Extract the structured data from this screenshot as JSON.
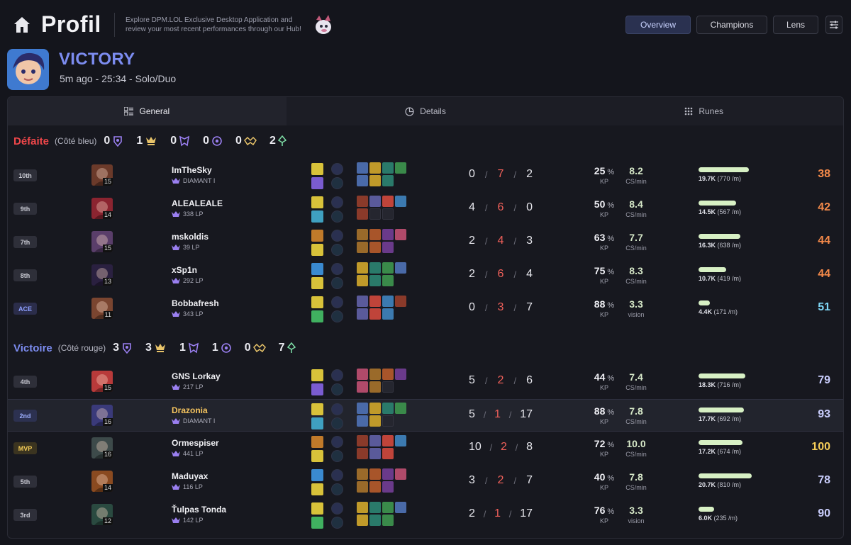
{
  "header": {
    "title": "Profil",
    "promo": "Explore DPM.LOL Exclusive Desktop Application and review your most recent performances through our Hub!",
    "nav": [
      "Overview",
      "Champions",
      "Lens"
    ]
  },
  "match": {
    "result": "VICTORY",
    "meta": "5m ago - 25:34 - Solo/Duo"
  },
  "tabs": [
    "General",
    "Details",
    "Runes"
  ],
  "teams": [
    {
      "name": "Défaite",
      "side": "(Côté bleu)",
      "color": "#f0474a",
      "objectives": [
        "0",
        "1",
        "0",
        "0",
        "0",
        "2"
      ],
      "players": [
        {
          "badge": "10th",
          "champ_color": "#6b3a2a",
          "level": "15",
          "name": "ImTheSky",
          "rank": "DIAMANT I",
          "k": "0",
          "d": "7",
          "a": "2",
          "kp": "25",
          "cs": "8.2",
          "cs_label": "CS/min",
          "dmg": "19.7K",
          "dpm": "(770 /m)",
          "dmg_frac": 0.95,
          "score": "38",
          "score_color": "#f58a4a"
        },
        {
          "badge": "9th",
          "champ_color": "#8b2430",
          "level": "14",
          "name": "ALEALEALE",
          "rank": "338 LP",
          "k": "4",
          "d": "6",
          "a": "0",
          "kp": "50",
          "cs": "8.4",
          "cs_label": "CS/min",
          "dmg": "14.5K",
          "dpm": "(567 /m)",
          "dmg_frac": 0.7,
          "score": "42",
          "score_color": "#f58a4a"
        },
        {
          "badge": "7th",
          "champ_color": "#5a3e6a",
          "level": "15",
          "name": "mskoldis",
          "rank": "39 LP",
          "k": "2",
          "d": "4",
          "a": "3",
          "kp": "63",
          "cs": "7.7",
          "cs_label": "CS/min",
          "dmg": "16.3K",
          "dpm": "(638 /m)",
          "dmg_frac": 0.79,
          "score": "44",
          "score_color": "#f58a4a"
        },
        {
          "badge": "8th",
          "champ_color": "#2a2040",
          "level": "13",
          "name": "xSp1n",
          "rank": "292 LP",
          "k": "2",
          "d": "6",
          "a": "4",
          "kp": "75",
          "cs": "8.3",
          "cs_label": "CS/min",
          "dmg": "10.7K",
          "dpm": "(419 /m)",
          "dmg_frac": 0.52,
          "score": "44",
          "score_color": "#f58a4a"
        },
        {
          "badge": "ACE",
          "champ_color": "#7a4530",
          "level": "11",
          "name": "Bobbafresh",
          "rank": "343 LP",
          "k": "0",
          "d": "3",
          "a": "7",
          "kp": "88",
          "cs": "3.3",
          "cs_label": "vision",
          "dmg": "4.4K",
          "dpm": "(171 /m)",
          "dmg_frac": 0.21,
          "score": "51",
          "score_color": "#7fd6f5"
        }
      ]
    },
    {
      "name": "Victoire",
      "side": "(Côté rouge)",
      "color": "#7c8cf0",
      "objectives": [
        "3",
        "3",
        "1",
        "1",
        "0",
        "7"
      ],
      "players": [
        {
          "badge": "4th",
          "champ_color": "#b83a3a",
          "level": "15",
          "name": "GNS Lorkay",
          "rank": "217 LP",
          "k": "5",
          "d": "2",
          "a": "6",
          "kp": "44",
          "cs": "7.4",
          "cs_label": "CS/min",
          "dmg": "18.3K",
          "dpm": "(716 /m)",
          "dmg_frac": 0.88,
          "score": "79",
          "score_color": "#c9cdfc"
        },
        {
          "badge": "2nd",
          "champ_color": "#3a3a7a",
          "level": "16",
          "name": "Drazonia",
          "rank": "DIAMANT I",
          "k": "5",
          "d": "1",
          "a": "17",
          "kp": "88",
          "cs": "7.8",
          "cs_label": "CS/min",
          "dmg": "17.7K",
          "dpm": "(692 /m)",
          "dmg_frac": 0.85,
          "score": "93",
          "score_color": "#c9cdfc"
        },
        {
          "badge": "MVP",
          "champ_color": "#3d4a4a",
          "level": "16",
          "name": "Ormespiser",
          "rank": "441 LP",
          "k": "10",
          "d": "2",
          "a": "8",
          "kp": "72",
          "cs": "10.0",
          "cs_label": "CS/min",
          "dmg": "17.2K",
          "dpm": "(674 /m)",
          "dmg_frac": 0.83,
          "score": "100",
          "score_color": "#f5cd58"
        },
        {
          "badge": "5th",
          "champ_color": "#8a4a20",
          "level": "14",
          "name": "Maduyax",
          "rank": "116 LP",
          "k": "3",
          "d": "2",
          "a": "7",
          "kp": "40",
          "cs": "7.8",
          "cs_label": "CS/min",
          "dmg": "20.7K",
          "dpm": "(810 /m)",
          "dmg_frac": 1.0,
          "score": "78",
          "score_color": "#c9cdfc"
        },
        {
          "badge": "3rd",
          "champ_color": "#2a4a40",
          "level": "12",
          "name": "Ťulpas Tonda",
          "rank": "142 LP",
          "k": "2",
          "d": "1",
          "a": "17",
          "kp": "76",
          "cs": "3.3",
          "cs_label": "vision",
          "dmg": "6.0K",
          "dpm": "(235 /m)",
          "dmg_frac": 0.29,
          "score": "90",
          "score_color": "#c9cdfc"
        }
      ]
    }
  ]
}
